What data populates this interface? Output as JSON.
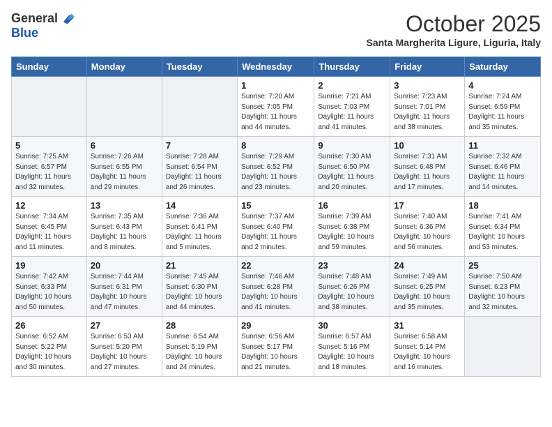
{
  "header": {
    "logo_line1": "General",
    "logo_line2": "Blue",
    "month": "October 2025",
    "location": "Santa Margherita Ligure, Liguria, Italy"
  },
  "weekdays": [
    "Sunday",
    "Monday",
    "Tuesday",
    "Wednesday",
    "Thursday",
    "Friday",
    "Saturday"
  ],
  "weeks": [
    [
      {
        "day": "",
        "info": ""
      },
      {
        "day": "",
        "info": ""
      },
      {
        "day": "",
        "info": ""
      },
      {
        "day": "1",
        "info": "Sunrise: 7:20 AM\nSunset: 7:05 PM\nDaylight: 11 hours\nand 44 minutes."
      },
      {
        "day": "2",
        "info": "Sunrise: 7:21 AM\nSunset: 7:03 PM\nDaylight: 11 hours\nand 41 minutes."
      },
      {
        "day": "3",
        "info": "Sunrise: 7:23 AM\nSunset: 7:01 PM\nDaylight: 11 hours\nand 38 minutes."
      },
      {
        "day": "4",
        "info": "Sunrise: 7:24 AM\nSunset: 6:59 PM\nDaylight: 11 hours\nand 35 minutes."
      }
    ],
    [
      {
        "day": "5",
        "info": "Sunrise: 7:25 AM\nSunset: 6:57 PM\nDaylight: 11 hours\nand 32 minutes."
      },
      {
        "day": "6",
        "info": "Sunrise: 7:26 AM\nSunset: 6:55 PM\nDaylight: 11 hours\nand 29 minutes."
      },
      {
        "day": "7",
        "info": "Sunrise: 7:28 AM\nSunset: 6:54 PM\nDaylight: 11 hours\nand 26 minutes."
      },
      {
        "day": "8",
        "info": "Sunrise: 7:29 AM\nSunset: 6:52 PM\nDaylight: 11 hours\nand 23 minutes."
      },
      {
        "day": "9",
        "info": "Sunrise: 7:30 AM\nSunset: 6:50 PM\nDaylight: 11 hours\nand 20 minutes."
      },
      {
        "day": "10",
        "info": "Sunrise: 7:31 AM\nSunset: 6:48 PM\nDaylight: 11 hours\nand 17 minutes."
      },
      {
        "day": "11",
        "info": "Sunrise: 7:32 AM\nSunset: 6:46 PM\nDaylight: 11 hours\nand 14 minutes."
      }
    ],
    [
      {
        "day": "12",
        "info": "Sunrise: 7:34 AM\nSunset: 6:45 PM\nDaylight: 11 hours\nand 11 minutes."
      },
      {
        "day": "13",
        "info": "Sunrise: 7:35 AM\nSunset: 6:43 PM\nDaylight: 11 hours\nand 8 minutes."
      },
      {
        "day": "14",
        "info": "Sunrise: 7:36 AM\nSunset: 6:41 PM\nDaylight: 11 hours\nand 5 minutes."
      },
      {
        "day": "15",
        "info": "Sunrise: 7:37 AM\nSunset: 6:40 PM\nDaylight: 11 hours\nand 2 minutes."
      },
      {
        "day": "16",
        "info": "Sunrise: 7:39 AM\nSunset: 6:38 PM\nDaylight: 10 hours\nand 59 minutes."
      },
      {
        "day": "17",
        "info": "Sunrise: 7:40 AM\nSunset: 6:36 PM\nDaylight: 10 hours\nand 56 minutes."
      },
      {
        "day": "18",
        "info": "Sunrise: 7:41 AM\nSunset: 6:34 PM\nDaylight: 10 hours\nand 53 minutes."
      }
    ],
    [
      {
        "day": "19",
        "info": "Sunrise: 7:42 AM\nSunset: 6:33 PM\nDaylight: 10 hours\nand 50 minutes."
      },
      {
        "day": "20",
        "info": "Sunrise: 7:44 AM\nSunset: 6:31 PM\nDaylight: 10 hours\nand 47 minutes."
      },
      {
        "day": "21",
        "info": "Sunrise: 7:45 AM\nSunset: 6:30 PM\nDaylight: 10 hours\nand 44 minutes."
      },
      {
        "day": "22",
        "info": "Sunrise: 7:46 AM\nSunset: 6:28 PM\nDaylight: 10 hours\nand 41 minutes."
      },
      {
        "day": "23",
        "info": "Sunrise: 7:48 AM\nSunset: 6:26 PM\nDaylight: 10 hours\nand 38 minutes."
      },
      {
        "day": "24",
        "info": "Sunrise: 7:49 AM\nSunset: 6:25 PM\nDaylight: 10 hours\nand 35 minutes."
      },
      {
        "day": "25",
        "info": "Sunrise: 7:50 AM\nSunset: 6:23 PM\nDaylight: 10 hours\nand 32 minutes."
      }
    ],
    [
      {
        "day": "26",
        "info": "Sunrise: 6:52 AM\nSunset: 5:22 PM\nDaylight: 10 hours\nand 30 minutes."
      },
      {
        "day": "27",
        "info": "Sunrise: 6:53 AM\nSunset: 5:20 PM\nDaylight: 10 hours\nand 27 minutes."
      },
      {
        "day": "28",
        "info": "Sunrise: 6:54 AM\nSunset: 5:19 PM\nDaylight: 10 hours\nand 24 minutes."
      },
      {
        "day": "29",
        "info": "Sunrise: 6:56 AM\nSunset: 5:17 PM\nDaylight: 10 hours\nand 21 minutes."
      },
      {
        "day": "30",
        "info": "Sunrise: 6:57 AM\nSunset: 5:16 PM\nDaylight: 10 hours\nand 18 minutes."
      },
      {
        "day": "31",
        "info": "Sunrise: 6:58 AM\nSunset: 5:14 PM\nDaylight: 10 hours\nand 16 minutes."
      },
      {
        "day": "",
        "info": ""
      }
    ]
  ]
}
